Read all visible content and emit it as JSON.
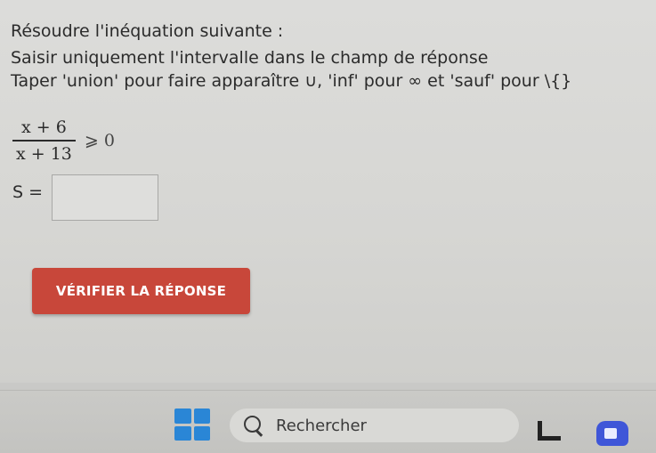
{
  "instructions": {
    "line1": "Résoudre l'inéquation suivante :",
    "line2": "Saisir uniquement l'intervalle dans le champ de réponse",
    "line3": "Taper 'union' pour faire apparaître ∪, 'inf' pour ∞ et 'sauf' pour \\{}"
  },
  "inequation": {
    "numerator": "x + 6",
    "denominator": "x + 13",
    "relation": "⩾ 0"
  },
  "answer": {
    "label": "S =",
    "value": ""
  },
  "verify_button": {
    "label": "VÉRIFIER LA RÉPONSE",
    "color": "#c8473a"
  },
  "taskbar": {
    "search_text": "Rechercher",
    "start_icon": "windows-logo-icon",
    "search_icon": "search-icon",
    "app_icons": [
      "app-l-shape-icon",
      "camera-app-icon"
    ],
    "accent": "#2a86d6"
  }
}
